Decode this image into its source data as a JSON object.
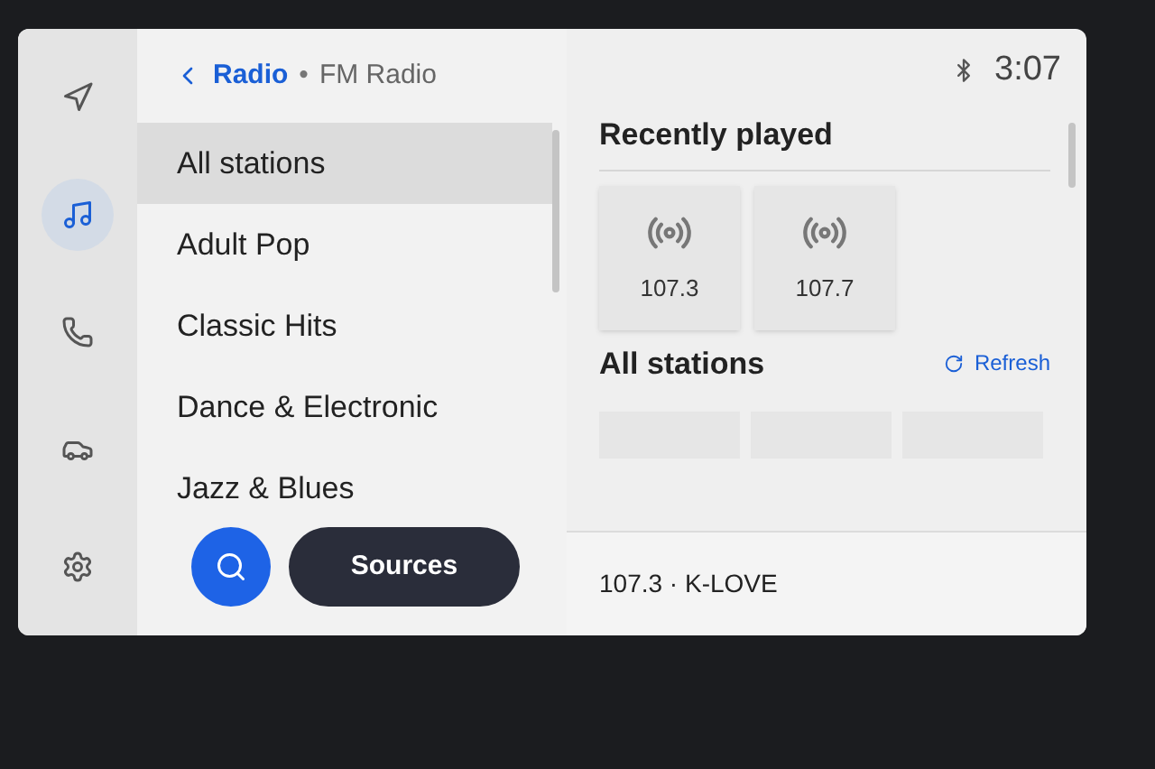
{
  "header": {
    "title": "Radio",
    "separator": "•",
    "subtitle": "FM Radio"
  },
  "status_bar": {
    "time": "3:07"
  },
  "nav": [
    {
      "kind": "navigation",
      "selected": false
    },
    {
      "kind": "music",
      "selected": true
    },
    {
      "kind": "phone",
      "selected": false
    },
    {
      "kind": "car",
      "selected": false
    },
    {
      "kind": "settings",
      "selected": false
    }
  ],
  "categories": [
    {
      "label": "All stations",
      "selected": true
    },
    {
      "label": "Adult Pop",
      "selected": false
    },
    {
      "label": "Classic Hits",
      "selected": false
    },
    {
      "label": "Dance & Electronic",
      "selected": false
    },
    {
      "label": "Jazz & Blues",
      "selected": false
    }
  ],
  "sources_button": "Sources",
  "recently_played": {
    "title": "Recently played",
    "stations": [
      {
        "frequency": "107.3"
      },
      {
        "frequency": "107.7"
      }
    ]
  },
  "all_stations": {
    "title": "All stations",
    "refresh": "Refresh"
  },
  "now_playing": "107.3 · K-LOVE"
}
